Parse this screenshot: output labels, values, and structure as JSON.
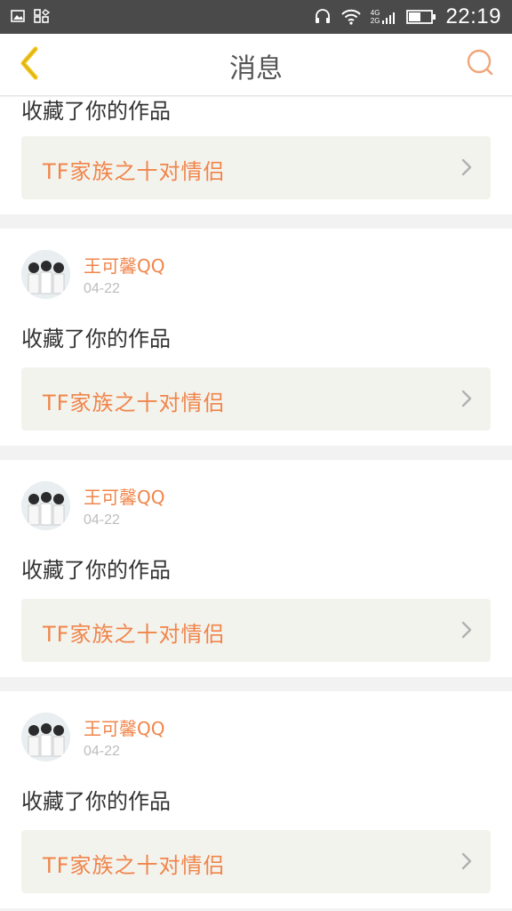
{
  "status_bar": {
    "time": "22:19",
    "network_top": "4G",
    "network_bottom": "2G",
    "icons": [
      "image-icon",
      "apps-icon",
      "headphones-icon",
      "wifi-icon",
      "signal-icon",
      "battery-icon"
    ]
  },
  "header": {
    "title": "消息",
    "back_icon": "chevron-left-icon",
    "search_icon": "search-icon"
  },
  "colors": {
    "accent": "#f0854a",
    "back_arrow": "#f5c518",
    "background": "#f2f2f2",
    "link_bg": "#f3f3ee"
  },
  "notifications": [
    {
      "action": "收藏了你的作品",
      "work_title": "TF家族之十对情侣"
    },
    {
      "user": "王可馨QQ",
      "date": "04-22",
      "action": "收藏了你的作品",
      "work_title": "TF家族之十对情侣"
    },
    {
      "user": "王可馨QQ",
      "date": "04-22",
      "action": "收藏了你的作品",
      "work_title": "TF家族之十对情侣"
    },
    {
      "user": "王可馨QQ",
      "date": "04-22",
      "action": "收藏了你的作品",
      "work_title": "TF家族之十对情侣"
    }
  ]
}
